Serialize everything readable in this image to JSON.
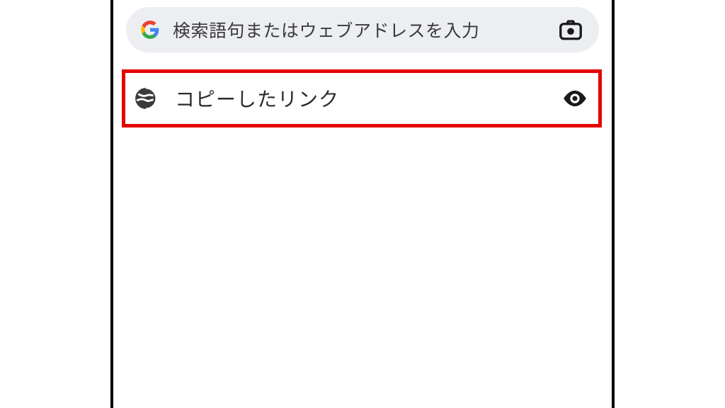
{
  "search": {
    "placeholder": "検索語句またはウェブアドレスを入力"
  },
  "suggestion": {
    "label": "コピーしたリンク"
  },
  "colors": {
    "highlight_border": "#e60000",
    "search_bg": "#eceef1"
  }
}
